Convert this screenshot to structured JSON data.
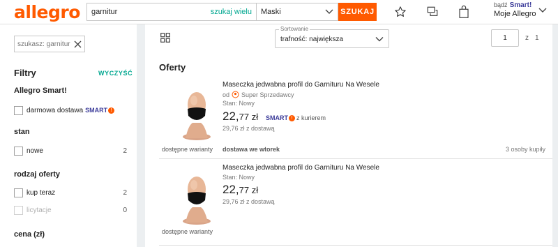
{
  "header": {
    "logo": "allegro",
    "search_value": "garnitur",
    "search_many": "szukaj wielu",
    "category": "Maski",
    "search_button": "SZUKAJ",
    "account_pre": "bądź",
    "account_smart": "Smart!",
    "account_label": "Moje Allegro"
  },
  "sidebar": {
    "search_chip": "szukasz: garnitur",
    "filters_title": "Filtry",
    "clear": "WYCZYŚĆ",
    "sections": [
      {
        "title": "Allegro Smart!",
        "options": [
          {
            "label": "darmowa dostawa",
            "smart": "SMART",
            "count": ""
          }
        ]
      },
      {
        "title": "stan",
        "options": [
          {
            "label": "nowe",
            "count": "2"
          }
        ]
      },
      {
        "title": "rodzaj oferty",
        "options": [
          {
            "label": "kup teraz",
            "count": "2"
          },
          {
            "label": "licytacje",
            "count": "0"
          }
        ]
      },
      {
        "title": "cena (zł)",
        "options": []
      }
    ]
  },
  "main": {
    "sort_legend": "Sortowanie",
    "sort_value": "trafność: największa",
    "page_current": "1",
    "page_of": "z",
    "page_total": "1",
    "offers_title": "Oferty",
    "offers": [
      {
        "title": "Maseczka jedwabna profil do Garnituru Na Wesele",
        "seller_prefix": "od",
        "seller": "Super Sprzedawcy",
        "condition": "Stan: Nowy",
        "price_int": "22,",
        "price_cents": "77 zł",
        "smart": "SMART",
        "courier": "z kurierem",
        "with_delivery": "29,76 zł z dostawą",
        "variants": "dostępne warianty",
        "delivery_day": "dostawa we wtorek",
        "bought": "3 osoby kupiły"
      },
      {
        "title": "Maseczka jedwabna profil do Garnituru Na Wesele",
        "condition": "Stan: Nowy",
        "price_int": "22,",
        "price_cents": "77 zł",
        "with_delivery": "29,76 zł z dostawą",
        "variants": "dostępne warianty"
      }
    ]
  },
  "colors": {
    "brand": "#ff5a00",
    "accent": "#00a790",
    "smart": "#3e3e9b"
  }
}
